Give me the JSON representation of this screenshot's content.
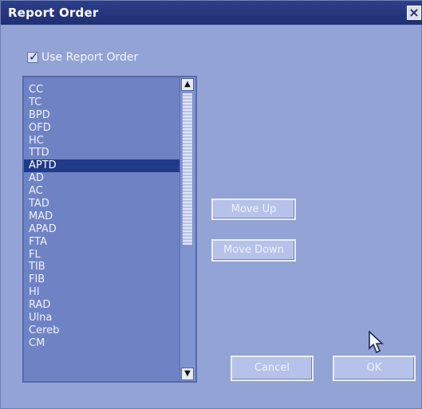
{
  "window": {
    "title": "Report Order",
    "close_label": "×"
  },
  "checkbox": {
    "label": "Use Report Order",
    "checked": true
  },
  "list": {
    "selected_index": 6,
    "items": [
      "CC",
      "TC",
      "BPD",
      "OFD",
      "HC",
      "TTD",
      "APTD",
      "AD",
      "AC",
      "TAD",
      "MAD",
      "APAD",
      "FTA",
      "FL",
      "TIB",
      "FIB",
      "HI",
      "RAD",
      "Ulna",
      "Cereb",
      "CM"
    ],
    "scroll_up_icon": "▲",
    "scroll_down_icon": "▼"
  },
  "buttons": {
    "move_up": "Move Up",
    "move_down": "Move Down",
    "cancel": "Cancel",
    "ok": "OK"
  },
  "icons": {
    "checkmark": "check-icon",
    "cursor": "mouse-pointer-icon"
  },
  "colors": {
    "titlebar": "#223484",
    "window": "#93a3d6",
    "selection": "#213a88"
  }
}
